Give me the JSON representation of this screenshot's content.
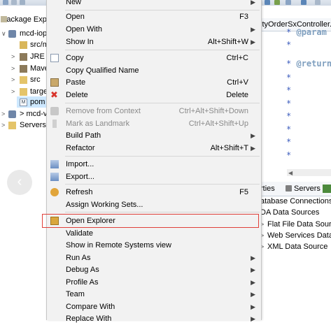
{
  "package_explorer": {
    "title": "Package Exp",
    "tree": [
      {
        "label": "mcd-iop",
        "icon": "project-icon"
      },
      {
        "label": "src/m",
        "icon": "source-folder-icon"
      },
      {
        "label": "JRE S",
        "icon": "library-icon"
      },
      {
        "label": "Mave",
        "icon": "library-icon"
      },
      {
        "label": "src",
        "icon": "folder-icon"
      },
      {
        "label": "targe",
        "icon": "folder-icon"
      },
      {
        "label": "pom",
        "icon": "xml-file-icon"
      },
      {
        "label": "> mcd-v",
        "icon": "project-icon"
      },
      {
        "label": "Servers",
        "icon": "folder-icon"
      }
    ]
  },
  "editor": {
    "tab_title": "ityOrderSxController.ja",
    "lines": [
      {
        "star": "*",
        "tag": "@param"
      },
      {
        "star": "*",
        "tag": ""
      },
      {
        "star": "*",
        "tag": "@return"
      },
      {
        "star": "*",
        "tag": ""
      },
      {
        "star": "*",
        "tag": ""
      },
      {
        "star": "*",
        "tag": ""
      },
      {
        "star": "*",
        "tag": ""
      },
      {
        "star": "*",
        "tag": ""
      },
      {
        "star": "*",
        "tag": ""
      },
      {
        "star": "*",
        "tag": ""
      }
    ]
  },
  "bottom_panel": {
    "tabs_text": "rties",
    "servers_tab": "Servers",
    "rows": [
      {
        "label": "atabase Connections"
      },
      {
        "label": "DA Data Sources"
      },
      {
        "label": "Flat File Data Source"
      },
      {
        "label": "Web Services Data S"
      },
      {
        "label": "XML Data Source"
      }
    ]
  },
  "context_menu": {
    "items": {
      "new": {
        "label": "New"
      },
      "open": {
        "label": "Open",
        "shortcut": "F3"
      },
      "open_with": {
        "label": "Open With"
      },
      "show_in": {
        "label": "Show In",
        "shortcut": "Alt+Shift+W"
      },
      "copy": {
        "label": "Copy",
        "shortcut": "Ctrl+C"
      },
      "copy_qualified": {
        "label": "Copy Qualified Name"
      },
      "paste": {
        "label": "Paste",
        "shortcut": "Ctrl+V"
      },
      "delete": {
        "label": "Delete",
        "shortcut": "Delete"
      },
      "remove_from_context": {
        "label": "Remove from Context",
        "shortcut": "Ctrl+Alt+Shift+Down"
      },
      "mark_as_landmark": {
        "label": "Mark as Landmark",
        "shortcut": "Ctrl+Alt+Shift+Up"
      },
      "build_path": {
        "label": "Build Path"
      },
      "refactor": {
        "label": "Refactor",
        "shortcut": "Alt+Shift+T"
      },
      "import": {
        "label": "Import..."
      },
      "export": {
        "label": "Export..."
      },
      "refresh": {
        "label": "Refresh",
        "shortcut": "F5"
      },
      "assign_working_sets": {
        "label": "Assign Working Sets..."
      },
      "open_explorer": {
        "label": "Open Explorer"
      },
      "validate": {
        "label": "Validate"
      },
      "show_in_remote": {
        "label": "Show in Remote Systems view"
      },
      "run_as": {
        "label": "Run As"
      },
      "debug_as": {
        "label": "Debug As"
      },
      "profile_as": {
        "label": "Profile As"
      },
      "team": {
        "label": "Team"
      },
      "compare_with": {
        "label": "Compare With"
      },
      "replace_with": {
        "label": "Replace With"
      }
    }
  },
  "colors": {
    "menu_bg": "#f2f2f2",
    "highlight_border": "#e0403a",
    "disabled_text": "#8a8a8a",
    "javadoc_blue": "#3f5fbf",
    "javadoc_tag": "#7f9fbf"
  }
}
